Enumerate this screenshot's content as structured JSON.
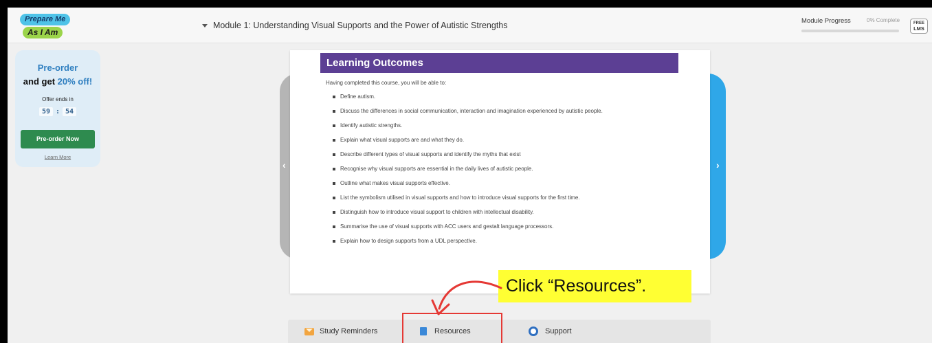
{
  "header": {
    "logo_top": "Prepare Me",
    "logo_bottom": "As I Am",
    "module_title": "Module 1: Understanding Visual Supports and the Power of Autistic Strengths",
    "progress_label": "Module Progress",
    "progress_percent_text": "0% Complete",
    "progress_value": 0,
    "badge_top": "FREE",
    "badge_bottom": "LMS"
  },
  "promo": {
    "line1": "Pre-order",
    "line2_prefix": "and get ",
    "line2_highlight": "20% off!",
    "offer_text": "Offer ends in",
    "minutes": "59",
    "separator": ":",
    "seconds": "54",
    "button_label": "Pre-order Now",
    "learn_more": "Learn More"
  },
  "card": {
    "banner_title": "Learning Outcomes",
    "intro": "Having completed this course, you will be able to:",
    "outcomes": [
      "Define autism.",
      "Discuss the differences in social communication, interaction and imagination experienced by autistic people.",
      "Identify autistic strengths.",
      "Explain what visual supports are and what they do.",
      "Describe different types of visual supports and identify the myths that exist",
      "Recognise why visual supports are essential in the daily lives of autistic people.",
      "Outline what makes visual supports effective.",
      "List the symbolism utilised in visual supports and how to introduce visual supports for the first time.",
      "Distinguish how to introduce visual support to children with intellectual disability.",
      "Summarise the use of visual supports with ACC users and gestalt language processors.",
      "Explain how to design supports from a UDL perspective."
    ]
  },
  "callout": {
    "text": "Click “Resources”."
  },
  "tabs": {
    "reminders": "Study Reminders",
    "resources": "Resources",
    "support": "Support"
  },
  "colors": {
    "banner": "#5c3f94",
    "accent_blue": "#2fa7e8",
    "button_green": "#2e8b4f",
    "callout_yellow": "#ffff33",
    "highlight_red": "#e53935"
  }
}
